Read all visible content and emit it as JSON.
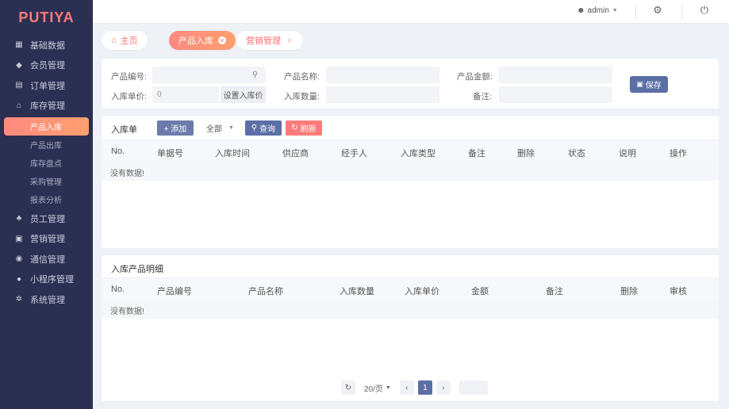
{
  "app": {
    "logo": "PUTIYA"
  },
  "sidebar": {
    "items": [
      {
        "label": "基础数据",
        "icon": "grid-icon",
        "glyph": "▦"
      },
      {
        "label": "会员管理",
        "icon": "diamond-icon",
        "glyph": "◆"
      },
      {
        "label": "订单管理",
        "icon": "list-icon",
        "glyph": "▤"
      },
      {
        "label": "库存管理",
        "icon": "warehouse-icon",
        "glyph": "⌂"
      }
    ],
    "sub_items": [
      {
        "label": "产品入库",
        "active": true
      },
      {
        "label": "产品出库",
        "active": false
      },
      {
        "label": "库存盘点",
        "active": false
      },
      {
        "label": "采购管理",
        "active": false
      },
      {
        "label": "报表分析",
        "active": false
      }
    ],
    "items_after": [
      {
        "label": "员工管理",
        "icon": "staff-icon",
        "glyph": "♣"
      },
      {
        "label": "营销管理",
        "icon": "gift-icon",
        "glyph": "▣"
      },
      {
        "label": "通信管理",
        "icon": "message-icon",
        "glyph": "◉"
      },
      {
        "label": "小程序管理",
        "icon": "miniapp-icon",
        "glyph": "●"
      },
      {
        "label": "系统管理",
        "icon": "settings-icon",
        "glyph": "✲"
      }
    ]
  },
  "topbar": {
    "user": "admin"
  },
  "tabs": [
    {
      "label": "主页",
      "icon": "home-icon"
    },
    {
      "label": "产品入库",
      "active": true
    },
    {
      "label": "营销管理"
    }
  ],
  "form": {
    "product_code_label": "产品编号:",
    "product_name_label": "产品名称:",
    "product_amount_label": "产品金额:",
    "unit_price_label": "入库单价:",
    "unit_price_value": "0",
    "set_price_button": "设置入库价",
    "quantity_label": "入库数量:",
    "remark_label": "备注:",
    "save_button": "保存"
  },
  "list": {
    "title": "入库单",
    "add_button": "+ 添加",
    "filter_value": "全部",
    "query_button": "查询",
    "refresh_button": "刷新",
    "columns": [
      "No.",
      "单据号",
      "入库时间",
      "供应商",
      "经手人",
      "入库类型",
      "备注",
      "删除",
      "状态",
      "说明",
      "操作"
    ],
    "empty_text": "没有数据!"
  },
  "detail": {
    "title": "入库产品明细",
    "columns": [
      "No.",
      "产品编号",
      "产品名称",
      "入库数量",
      "入库单价",
      "金额",
      "备注",
      "删除",
      "审核"
    ],
    "empty_text": "没有数据!"
  },
  "pager": {
    "page_size": "20/页",
    "current_page": "1"
  },
  "colors": {
    "sidebar_bg": "#2b2f52",
    "accent": "#ff8a80",
    "button_blue": "#5b6fa6",
    "logo": "#ff7a7a"
  }
}
